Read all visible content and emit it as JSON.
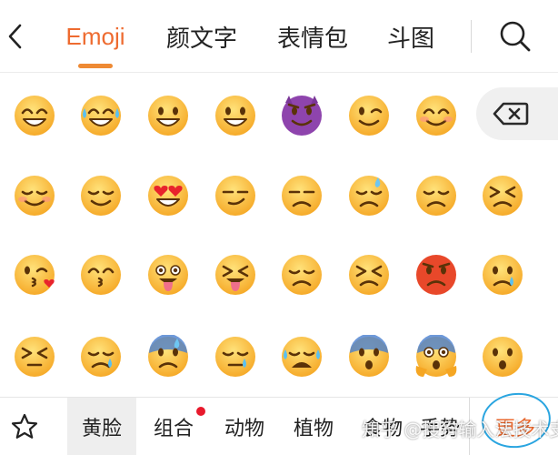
{
  "top_tabs": [
    {
      "label": "Emoji",
      "active": true
    },
    {
      "label": "颜文字",
      "active": false
    },
    {
      "label": "表情包",
      "active": false
    },
    {
      "label": "斗图",
      "active": false
    }
  ],
  "icons": {
    "back": "chevron-left-icon",
    "search": "search-icon",
    "backspace": "backspace-icon",
    "favorites": "star-icon"
  },
  "emoji_grid": [
    "grinning-face-with-smiling-eyes",
    "face-with-tears-of-joy",
    "grinning-face",
    "grinning-face-wide",
    "smiling-face-with-horns",
    "winking-face",
    "smiling-face-with-smiling-eyes",
    "relaxed-face",
    "relieved-face",
    "smiling-face-with-heart-eyes",
    "smirking-face",
    "unamused-face",
    "downcast-face-with-sweat",
    "pensive-face",
    "confounded-face",
    "face-blowing-a-kiss",
    "kissing-face-with-smiling-eyes",
    "winking-face-with-tongue",
    "squinting-face-with-tongue",
    "disappointed-face",
    "persevering-face",
    "pouting-face",
    "crying-face",
    "tired-face",
    "sad-but-relieved-face",
    "anxious-face-with-sweat",
    "sleepy-face",
    "loudly-crying-face",
    "fearful-face",
    "face-screaming-in-fear",
    "hushed-face"
  ],
  "categories": [
    {
      "label": "黄脸",
      "active": true,
      "badge": false
    },
    {
      "label": "组合",
      "active": false,
      "badge": true
    },
    {
      "label": "动物",
      "active": false,
      "badge": false
    },
    {
      "label": "植物",
      "active": false,
      "badge": false
    },
    {
      "label": "食物",
      "active": false,
      "badge": false
    },
    {
      "label": "手势",
      "active": false,
      "badge": false
    }
  ],
  "more_label": "更多",
  "watermark": "知乎 @搜狗输入法技术支持",
  "colors": {
    "accent": "#ee6b30",
    "underline": "#ee8a34",
    "badge": "#e8192c",
    "annotation_circle": "#2aa5e0",
    "emoji_yellow": "#ffc83a",
    "devil_purple": "#8e44ad",
    "angry_red": "#e8482a"
  }
}
